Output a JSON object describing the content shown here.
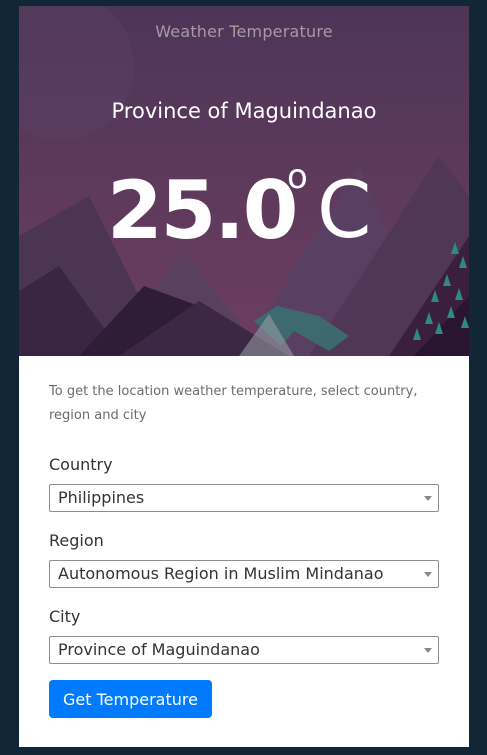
{
  "app_title": "Weather Temperature",
  "location_name": "Province of Maguindanao",
  "temperature": {
    "value": "25.0",
    "degree_symbol": "o",
    "unit": "C"
  },
  "instructions": "To get the location weather temperature, select country, region and city",
  "form": {
    "country": {
      "label": "Country",
      "selected": "Philippines"
    },
    "region": {
      "label": "Region",
      "selected": "Autonomous Region in Muslim Mindanao"
    },
    "city": {
      "label": "City",
      "selected": "Province of Maguindanao"
    },
    "submit_label": "Get Temperature"
  },
  "colors": {
    "page_background": "#132636",
    "hero_top": "#4b3356",
    "hero_bottom": "#6a3a5c",
    "button": "#007bff"
  }
}
